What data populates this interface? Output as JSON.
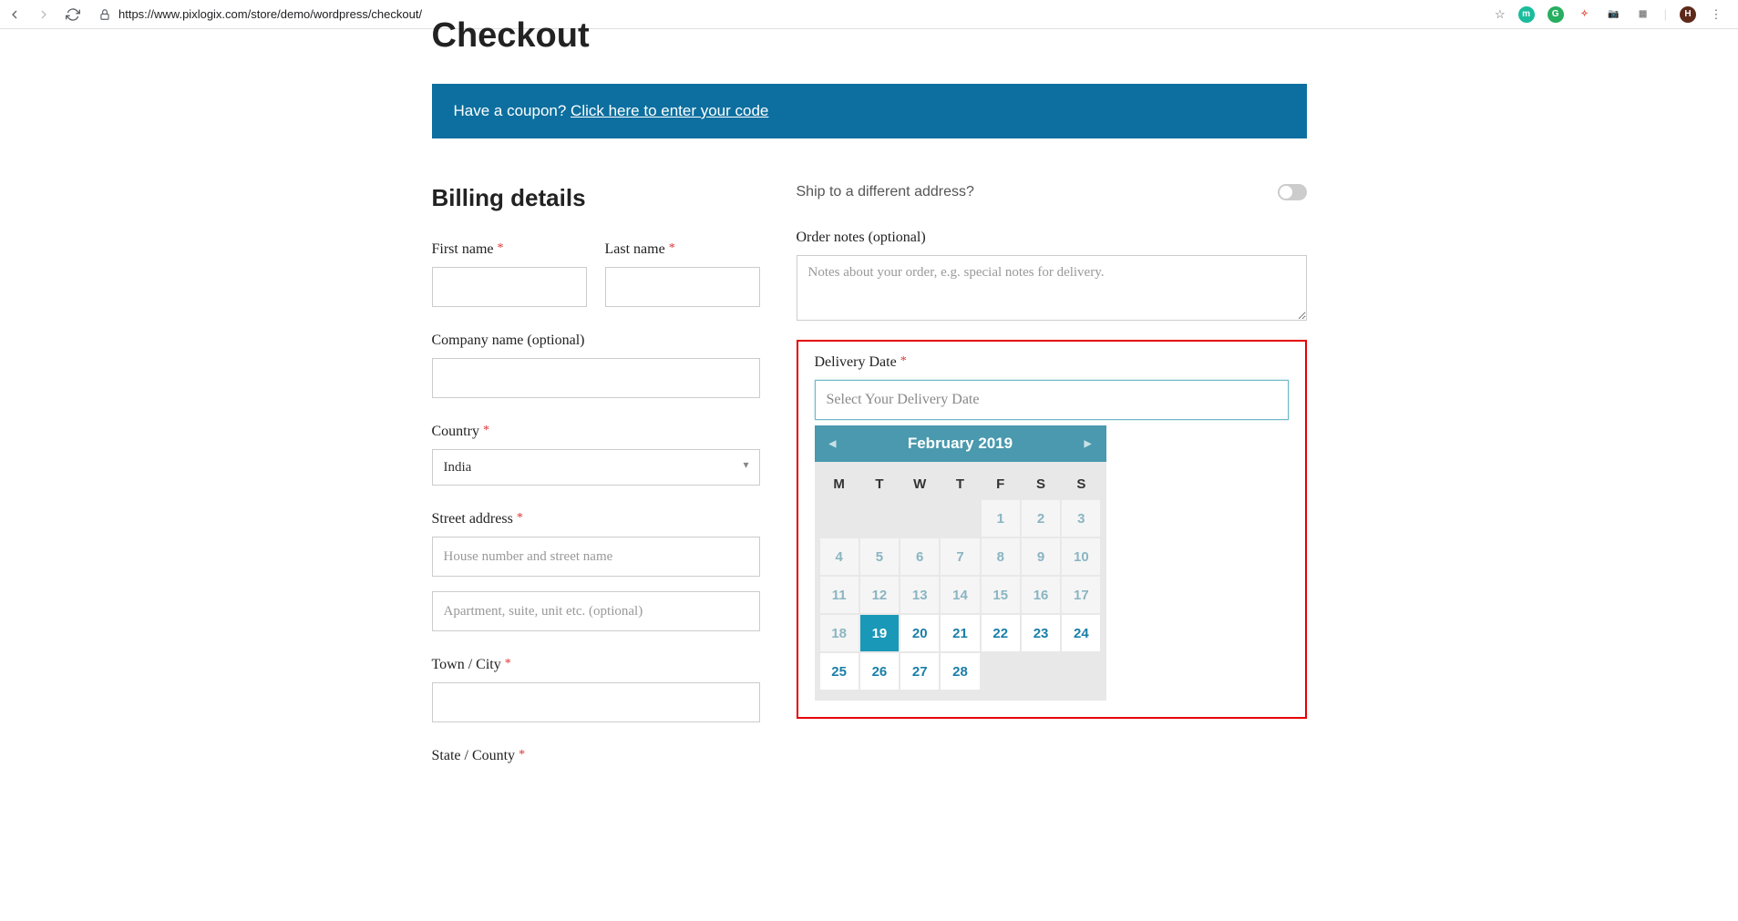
{
  "browser": {
    "url": "https://www.pixlogix.com/store/demo/wordpress/checkout/"
  },
  "page": {
    "title": "Checkout"
  },
  "coupon": {
    "prompt": "Have a coupon? ",
    "link": "Click here to enter your code"
  },
  "billing": {
    "heading": "Billing details",
    "first_name_label": "First name",
    "last_name_label": "Last name",
    "company_label": "Company name (optional)",
    "country_label": "Country",
    "country_value": "India",
    "street_label": "Street address",
    "street_placeholder": "House number and street name",
    "apt_placeholder": "Apartment, suite, unit etc. (optional)",
    "town_label": "Town / City",
    "state_label": "State / County"
  },
  "shipping": {
    "toggle_label": "Ship to a different address?",
    "notes_label": "Order notes (optional)",
    "notes_placeholder": "Notes about your order, e.g. special notes for delivery."
  },
  "delivery": {
    "label": "Delivery Date",
    "placeholder": "Select Your Delivery Date"
  },
  "calendar": {
    "month_year": "February 2019",
    "day_headers": [
      "M",
      "T",
      "W",
      "T",
      "F",
      "S",
      "S"
    ],
    "weeks": [
      [
        {
          "d": "",
          "t": "empty"
        },
        {
          "d": "",
          "t": "empty"
        },
        {
          "d": "",
          "t": "empty"
        },
        {
          "d": "",
          "t": "empty"
        },
        {
          "d": "1",
          "t": "past"
        },
        {
          "d": "2",
          "t": "past"
        },
        {
          "d": "3",
          "t": "past"
        }
      ],
      [
        {
          "d": "4",
          "t": "past"
        },
        {
          "d": "5",
          "t": "past"
        },
        {
          "d": "6",
          "t": "past"
        },
        {
          "d": "7",
          "t": "past"
        },
        {
          "d": "8",
          "t": "past"
        },
        {
          "d": "9",
          "t": "past"
        },
        {
          "d": "10",
          "t": "past"
        }
      ],
      [
        {
          "d": "11",
          "t": "past"
        },
        {
          "d": "12",
          "t": "past"
        },
        {
          "d": "13",
          "t": "past"
        },
        {
          "d": "14",
          "t": "past"
        },
        {
          "d": "15",
          "t": "past"
        },
        {
          "d": "16",
          "t": "past"
        },
        {
          "d": "17",
          "t": "past"
        }
      ],
      [
        {
          "d": "18",
          "t": "past"
        },
        {
          "d": "19",
          "t": "today"
        },
        {
          "d": "20",
          "t": "avail"
        },
        {
          "d": "21",
          "t": "avail"
        },
        {
          "d": "22",
          "t": "avail"
        },
        {
          "d": "23",
          "t": "avail"
        },
        {
          "d": "24",
          "t": "avail"
        }
      ],
      [
        {
          "d": "25",
          "t": "avail"
        },
        {
          "d": "26",
          "t": "avail"
        },
        {
          "d": "27",
          "t": "avail"
        },
        {
          "d": "28",
          "t": "avail"
        },
        {
          "d": "",
          "t": "empty"
        },
        {
          "d": "",
          "t": "empty"
        },
        {
          "d": "",
          "t": "empty"
        }
      ]
    ]
  }
}
